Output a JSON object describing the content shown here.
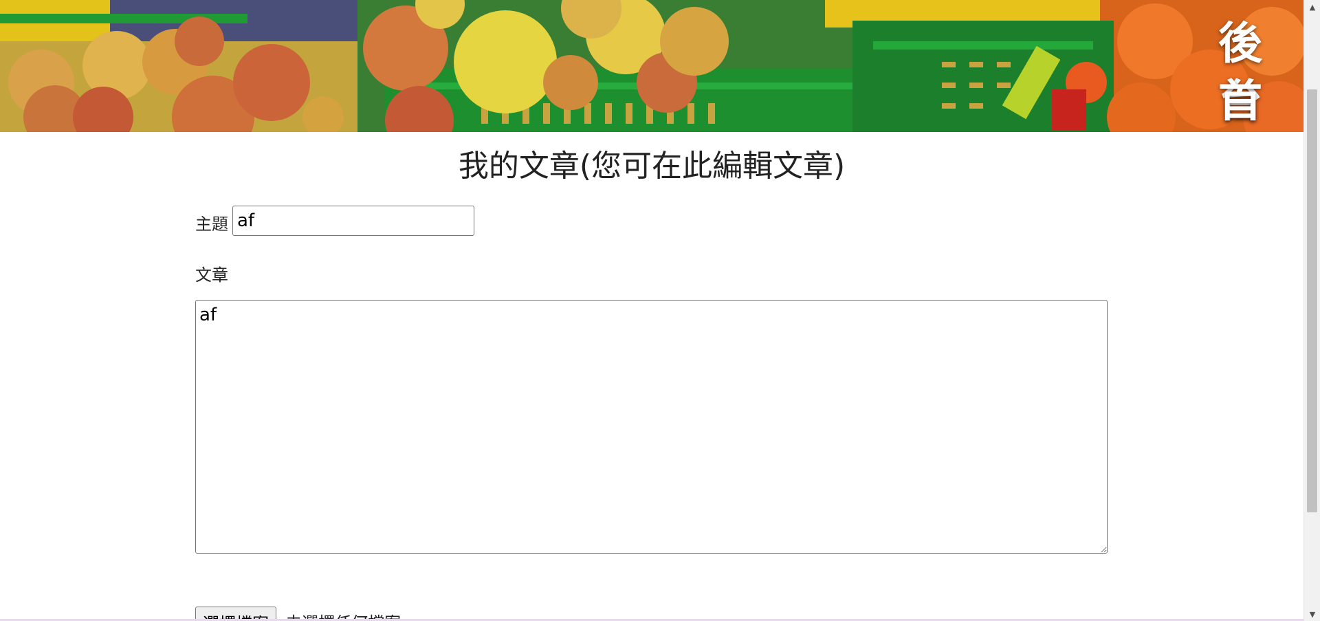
{
  "banner": {
    "image_description": "",
    "backstage_link": "後台",
    "home_link": "首頁"
  },
  "page": {
    "title": "我的文章(您可在此編輯文章)"
  },
  "form": {
    "subject_label": "主題",
    "subject_value": "af",
    "article_label": "文章",
    "article_value": "af",
    "file_button_label": "選擇檔案",
    "file_status": "未選擇任何檔案"
  },
  "colors": {
    "banner_green": "#2f8f3a",
    "link_text": "#ffffff",
    "page_bg": "#ffffff"
  }
}
